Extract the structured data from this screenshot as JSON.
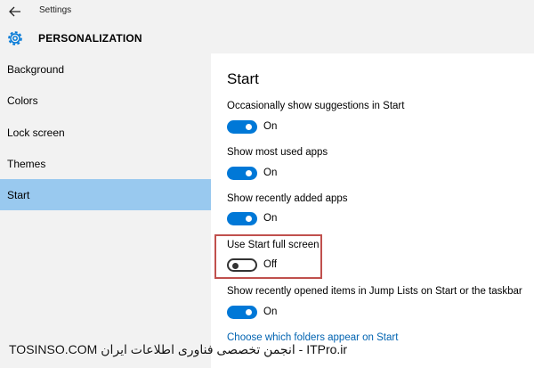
{
  "window": {
    "title": "Settings",
    "back_icon": "back-arrow-icon"
  },
  "header": {
    "icon": "gear-icon",
    "title": "PERSONALIZATION"
  },
  "sidebar": {
    "items": [
      {
        "label": "Background",
        "active": false
      },
      {
        "label": "Colors",
        "active": false
      },
      {
        "label": "Lock screen",
        "active": false
      },
      {
        "label": "Themes",
        "active": false
      },
      {
        "label": "Start",
        "active": true
      }
    ]
  },
  "main": {
    "heading": "Start",
    "settings": [
      {
        "label": "Occasionally show suggestions in Start",
        "state": "On"
      },
      {
        "label": "Show most used apps",
        "state": "On"
      },
      {
        "label": "Show recently added apps",
        "state": "On"
      },
      {
        "label": "Use Start full screen",
        "state": "Off"
      },
      {
        "label": "Show recently opened items in Jump Lists on Start or the taskbar",
        "state": "On"
      }
    ],
    "link": "Choose which folders appear on Start"
  },
  "watermark": "TOSINSO.COM انجمن تخصصی فناوری اطلاعات ایران - ITPro.ir",
  "colors": {
    "accent": "#0078d7",
    "active_nav": "#99c9ef",
    "highlight_border": "#c0504d",
    "link": "#0063b1"
  }
}
